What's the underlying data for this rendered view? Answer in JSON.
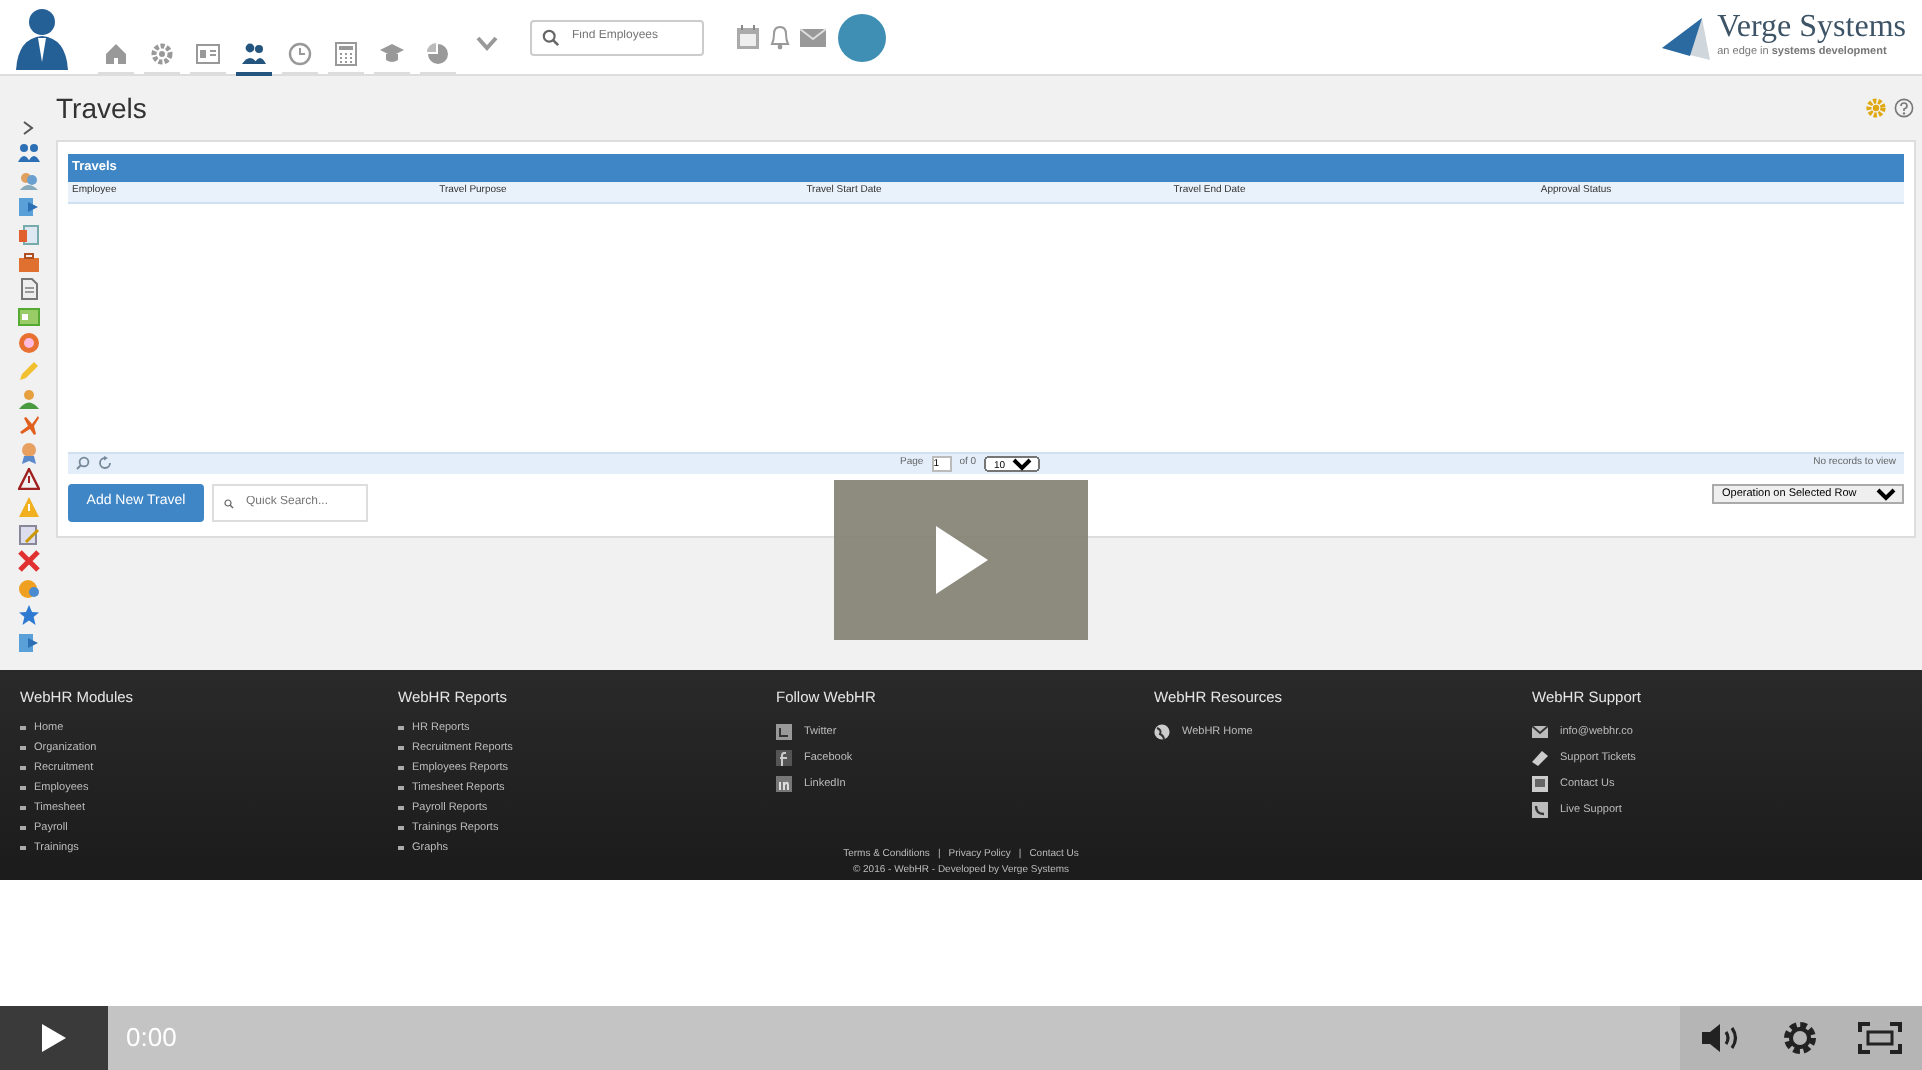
{
  "header": {
    "brand": {
      "name": "Verge Systems",
      "tagline": "an edge in **systems development**"
    },
    "nav_tabs": [
      {
        "selected": false
      },
      {
        "selected": false
      },
      {
        "selected": false
      },
      {
        "selected": true
      },
      {
        "selected": false
      },
      {
        "selected": false
      },
      {
        "selected": false
      },
      {
        "selected": false
      }
    ],
    "search": {
      "placeholder": "Find Employees"
    }
  },
  "page": {
    "title": "Travels"
  },
  "grid": {
    "title": "Travels",
    "columns": [
      "Employee",
      "Travel Purpose",
      "Travel Start Date",
      "Travel End Date",
      "Approval Status"
    ],
    "pager": {
      "page_label": "Page",
      "page_value": "1",
      "of_label": "of 0",
      "page_size": "10"
    },
    "status": "No records to view"
  },
  "actions": {
    "add_button": "Add New Travel",
    "search": {
      "placeholder": "Quick Search..."
    },
    "operation_select": "Operation on Selected Row"
  },
  "footer": {
    "columns": [
      {
        "heading": "WebHR Modules",
        "kind": "bullets",
        "items": [
          "Home",
          "Organization",
          "Recruitment",
          "Employees",
          "Timesheet",
          "Payroll",
          "Trainings"
        ]
      },
      {
        "heading": "WebHR Reports",
        "kind": "bullets",
        "items": [
          "HR Reports",
          "Recruitment Reports",
          "Employees Reports",
          "Timesheet Reports",
          "Payroll Reports",
          "Trainings Reports",
          "Graphs"
        ]
      },
      {
        "heading": "Follow WebHR",
        "kind": "social",
        "items": [
          "Twitter",
          "Facebook",
          "LinkedIn"
        ]
      },
      {
        "heading": "WebHR Resources",
        "kind": "resources",
        "items": [
          "WebHR Home"
        ]
      },
      {
        "heading": "WebHR Support",
        "kind": "support",
        "items": [
          "info@webhr.co",
          "Support Tickets",
          "Contact Us",
          "Live Support"
        ]
      }
    ],
    "legal": {
      "links": [
        "Terms & Conditions",
        "Privacy Policy",
        "Contact Us"
      ],
      "separator": "|",
      "copyright": "© 2016 - WebHR - Developed by Verge Systems"
    }
  },
  "video": {
    "time": "0:00"
  }
}
